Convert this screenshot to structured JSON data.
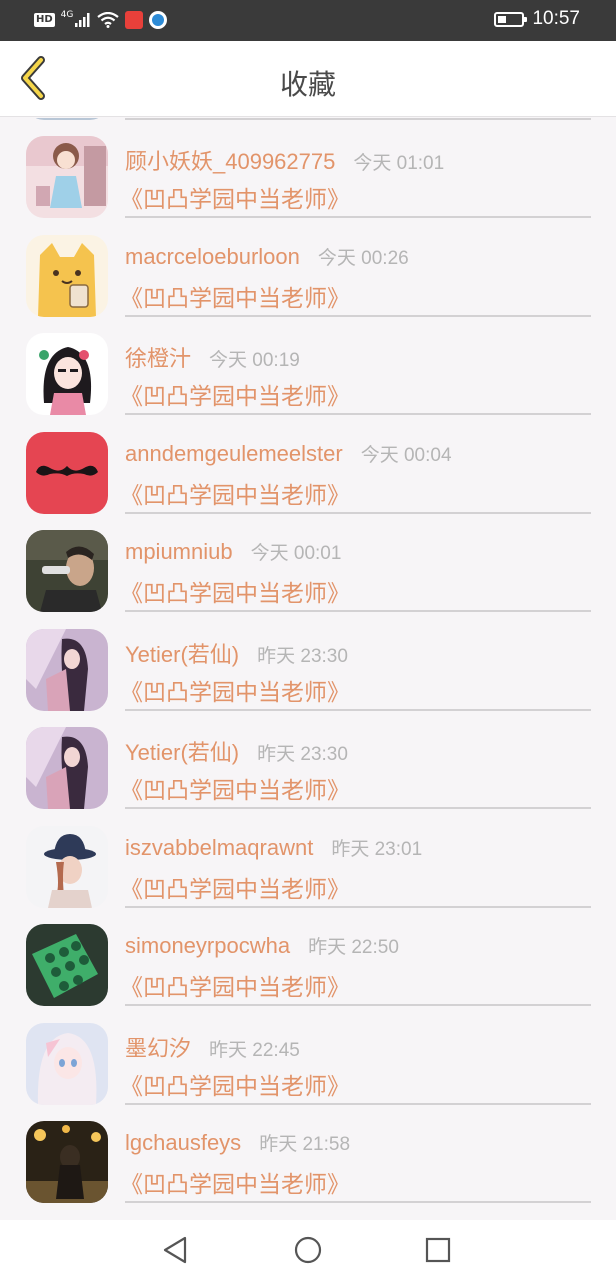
{
  "status_bar": {
    "hd": "HD",
    "network": "4G",
    "time": "10:57"
  },
  "header": {
    "title": "收藏",
    "back_icon": "chevron-left-icon"
  },
  "items": [
    {
      "name": "顾小妖妖_409962775",
      "time": "今天 01:01",
      "book": "《凹凸学园中当老师》"
    },
    {
      "name": "macrceloeburloon",
      "time": "今天 00:26",
      "book": "《凹凸学园中当老师》"
    },
    {
      "name": "徐橙汁",
      "time": "今天 00:19",
      "book": "《凹凸学园中当老师》"
    },
    {
      "name": "anndemgeulemeelster",
      "time": "今天 00:04",
      "book": "《凹凸学园中当老师》"
    },
    {
      "name": "mpiumniub",
      "time": "今天 00:01",
      "book": "《凹凸学园中当老师》"
    },
    {
      "name": "Yetier(若仙)",
      "time": "昨天 23:30",
      "book": "《凹凸学园中当老师》"
    },
    {
      "name": "Yetier(若仙)",
      "time": "昨天 23:30",
      "book": "《凹凸学园中当老师》"
    },
    {
      "name": "iszvabbelmaqrawnt",
      "time": "昨天 23:01",
      "book": "《凹凸学园中当老师》"
    },
    {
      "name": "simoneyrpocwha",
      "time": "昨天 22:50",
      "book": "《凹凸学园中当老师》"
    },
    {
      "name": "墨幻汐",
      "time": "昨天 22:45",
      "book": "《凹凸学园中当老师》"
    },
    {
      "name": "lgchausfeys",
      "time": "昨天 21:58",
      "book": "《凹凸学园中当老师》"
    }
  ],
  "nav": {
    "back_icon": "triangle-back-icon",
    "home_icon": "circle-home-icon",
    "recents_icon": "square-recents-icon"
  },
  "colors": {
    "accent": "#e2946a",
    "time": "#b5b5b5",
    "status_bar": "#3a3a3a"
  }
}
